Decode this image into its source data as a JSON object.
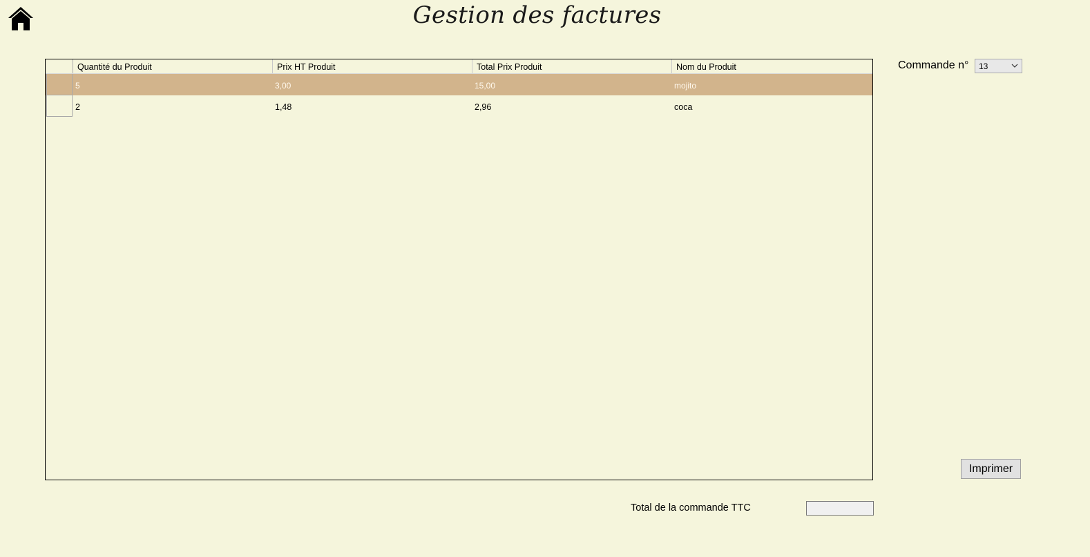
{
  "window": {
    "title": "Gestion des factures"
  },
  "home": {
    "icon": "home-icon"
  },
  "grid": {
    "columns": [
      "Quantité du Produit",
      "Prix HT Produit",
      "Total Prix Produit",
      "Nom du Produit"
    ],
    "rows": [
      [
        "5",
        "3,00",
        "15,00",
        "mojito"
      ],
      [
        "2",
        "1,48",
        "2,96",
        "coca"
      ]
    ],
    "selected_row": 0
  },
  "commande": {
    "label": "Commande n°",
    "selected": "13",
    "icon": "chevron-down-icon"
  },
  "print": {
    "label": "Imprimer"
  },
  "total": {
    "label": "Total de la commande TTC",
    "value": ""
  },
  "colors": {
    "background": "#f5f5dc",
    "selected_row": "#d2b48c"
  }
}
